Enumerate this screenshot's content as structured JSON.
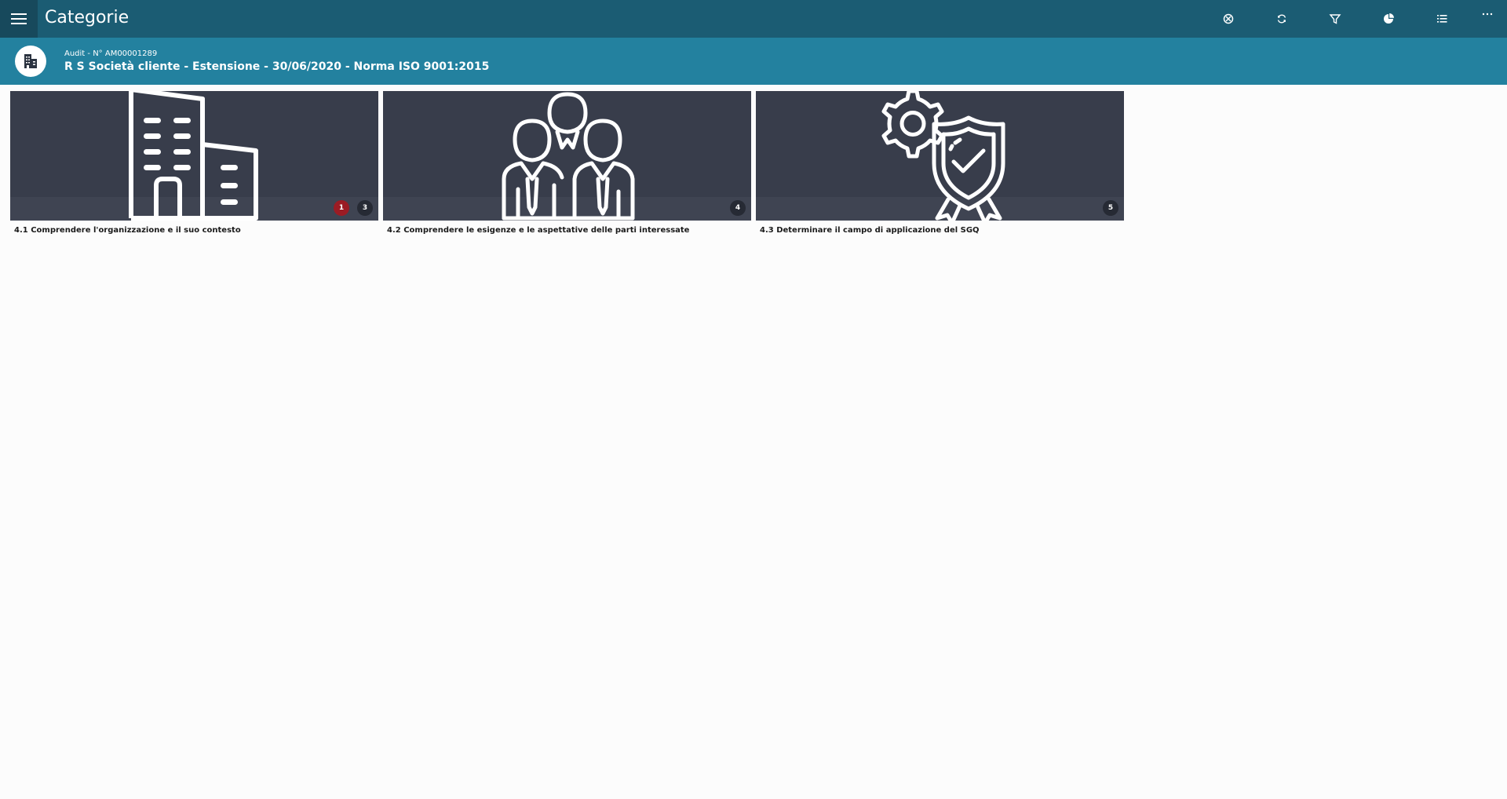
{
  "header": {
    "title": "Categorie",
    "menu_icon": "hamburger-menu-icon",
    "toolbar_icons": [
      "map-pin-icon",
      "sync-icon",
      "filter-icon",
      "pie-chart-icon",
      "list-icon",
      "more-icon"
    ],
    "background_color": "#1b5c73"
  },
  "audit": {
    "subtitle": "Audit - N° AM00001289",
    "title": "R S Società cliente - Estensione - 30/06/2020 - Norma ISO 9001:2015",
    "icon": "building-icon",
    "background_color": "#23819f"
  },
  "categories": [
    {
      "label": "4.1 Comprendere l'organizzazione e il suo contesto",
      "icon": "building-icon",
      "badges": [
        {
          "value": "1",
          "color": "#9b1c24"
        },
        {
          "value": "3",
          "color": "#262a34"
        }
      ]
    },
    {
      "label": "4.2 Comprendere le esigenze e le aspettative delle parti interessate",
      "icon": "people-group-icon",
      "badges": [
        {
          "value": "4",
          "color": "#262a34"
        }
      ]
    },
    {
      "label": "4.3 Determinare il campo di applicazione del SGQ",
      "icon": "gear-shield-icon",
      "badges": [
        {
          "value": "5",
          "color": "#262a34"
        }
      ]
    }
  ]
}
